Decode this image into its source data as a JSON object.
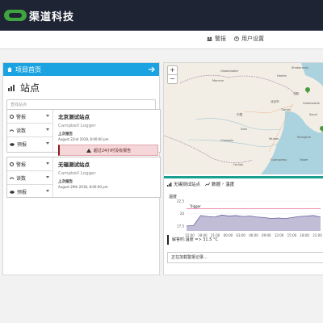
{
  "brand": {
    "logo_text": "渠道科技",
    "accent_color": "#3fa33f"
  },
  "topnav": {
    "alarm_label": "警报",
    "user_label": "用户设置"
  },
  "left": {
    "header_label": "项目首页",
    "title": "站点",
    "search_placeholder": "查找站点",
    "action_labels": [
      "警报",
      "读数",
      "预报"
    ],
    "sites": [
      {
        "name": "北京测试站点",
        "logger": "Campbell Logger",
        "last_label": "上次报告",
        "last_time": "August 22nd 2018, 8:00:00 pm",
        "alert": "超过24小时没有报告"
      },
      {
        "name": "无锡测试站点",
        "logger": "Campbell Logger",
        "last_label": "上次报告",
        "last_time": "August 29th 2018, 8:00:00 pm",
        "alert": ""
      }
    ]
  },
  "map": {
    "zoom_in": "+",
    "zoom_out": "−",
    "labels": [
      "Ulaanbaatar",
      "Монгол",
      "Harbin",
      "北京市",
      "Khabarovsk",
      "沈阳",
      "Tianjin",
      "中国",
      "Xian",
      "Chengdu",
      "Wuhan",
      "Shanghai",
      "Guangzhou",
      "Taipei",
      "Ha Noi",
      "Vladivostok",
      "Seoul"
    ]
  },
  "detail": {
    "site_name": "无锡测试站点",
    "data_label": "数据",
    "series_label": "温度",
    "readout": "解答时:温度 => 31.5 °C",
    "loading": "正在加载警报记录..."
  },
  "chart_data": {
    "type": "line",
    "ylabel": "温度",
    "x_ticks": [
      "15:00",
      "18:00",
      "21:00",
      "00:00",
      "03:00",
      "06:00",
      "09:00",
      "12:00",
      "15:00",
      "18:00",
      "21:00"
    ],
    "y_ticks": [
      22.5,
      20,
      17.5
    ],
    "trigger_label": "Trigger",
    "trigger_value": 21,
    "series": [
      {
        "values": [
          17.5,
          17.6,
          19.6,
          19.4,
          19.3,
          19.7,
          19.5,
          19.6,
          19.4,
          19.5,
          19.3,
          19.2,
          19.0,
          19.1,
          19.0,
          19.2,
          19.4,
          19.5,
          19.6,
          19.3
        ]
      }
    ],
    "ylim": [
      16.5,
      23
    ]
  }
}
